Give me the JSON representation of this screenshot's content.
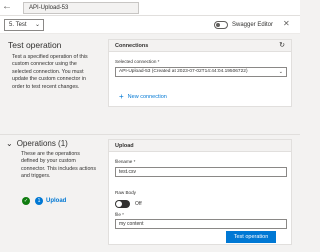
{
  "header": {
    "connector_name": "API-Upload-53",
    "back_icon": "back-arrow-icon"
  },
  "command_bar": {
    "step_select": "5. Test",
    "swagger_editor_label": "Swagger Editor",
    "swagger_editor_on": false,
    "close_icon": "close-icon"
  },
  "test_operation": {
    "title": "Test operation",
    "description": "Test a specified operation of this custom connector using the selected connection. You must update the custom connector in order to test recent changes."
  },
  "operations": {
    "title": "Operations (1)",
    "description": "These are the operations defined by your custom connector. This includes actions and triggers.",
    "items": [
      {
        "index": "1",
        "label": "Upload",
        "status": "success"
      }
    ]
  },
  "connections_card": {
    "title": "Connections",
    "refresh_icon": "refresh-icon",
    "selected_label": "Selected connection *",
    "selected_value": "API-Upload-53 (Created at 2023-07-02T14:44:04.19506722)",
    "new_connection": "New connection"
  },
  "upload_card": {
    "title": "Upload",
    "filename_label": "filename *",
    "filename_value": "test.csv",
    "raw_body_label": "Raw Body",
    "raw_body_state": "Off",
    "file_label": "file *",
    "file_value": "my content",
    "test_button": "Test operation"
  },
  "colors": {
    "accent": "#0078d4",
    "success": "#107c10",
    "background": "#f3f2f1"
  }
}
